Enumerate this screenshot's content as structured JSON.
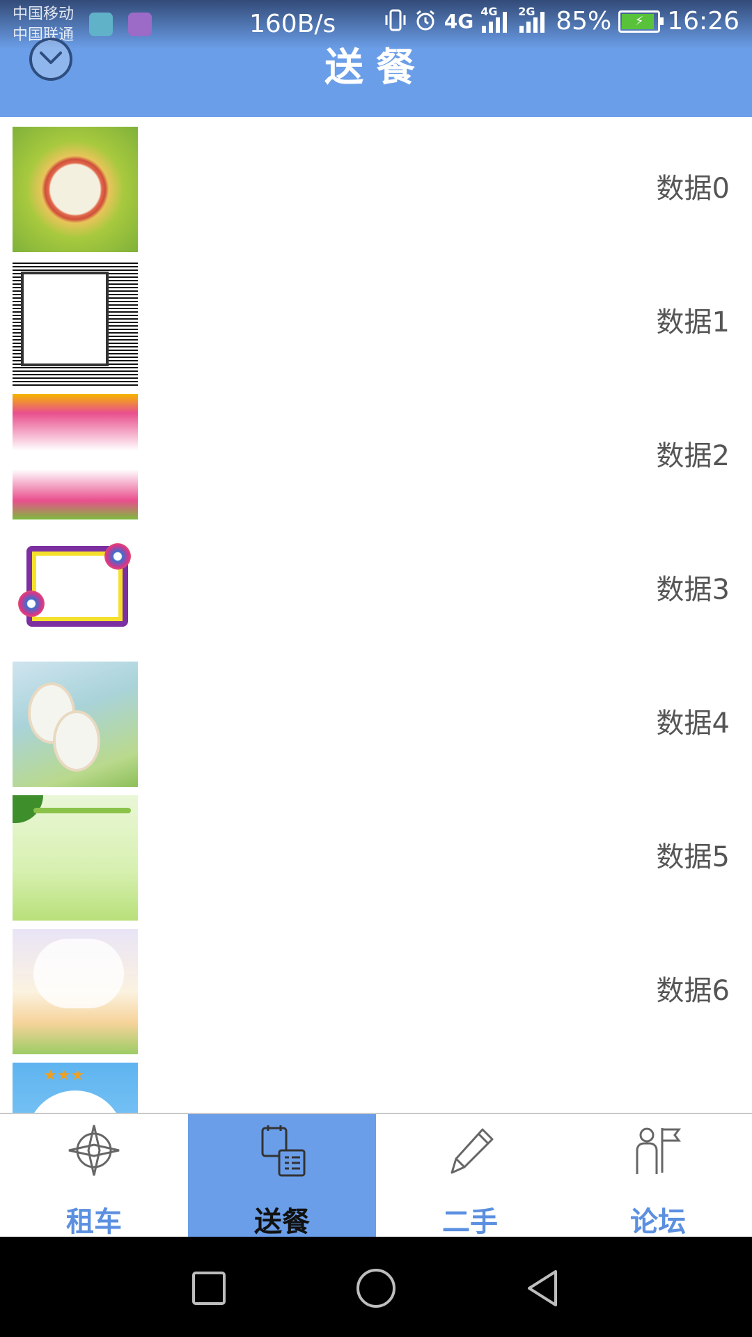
{
  "status_bar": {
    "carrier_1": "中国移动",
    "carrier_2": "中国联通",
    "net_speed": "160B/s",
    "network_1": "4G",
    "network_2": "4G",
    "network_3": "2G",
    "battery": "85%",
    "time": "16:26",
    "battery_color": "#57c23a"
  },
  "header": {
    "title": "送餐",
    "background": "#6b9ee8",
    "menu_icon": "chevron-down-circle-icon"
  },
  "list": {
    "items": [
      {
        "label": "数据0",
        "thumb": "floral-frame-thumbnail"
      },
      {
        "label": "数据1",
        "thumb": "sketch-frame-thumbnail"
      },
      {
        "label": "数据2",
        "thumb": "paint-splash-frame-thumbnail"
      },
      {
        "label": "数据3",
        "thumb": "colorful-frame-thumbnail"
      },
      {
        "label": "数据4",
        "thumb": "spring-frame-thumbnail"
      },
      {
        "label": "数据5",
        "thumb": "green-frame-thumbnail"
      },
      {
        "label": "数据6",
        "thumb": "cloud-frame-thumbnail"
      },
      {
        "label": "",
        "thumb": "study-star-thumbnail"
      }
    ]
  },
  "tabs": [
    {
      "label": "租车",
      "icon": "compass-icon",
      "active": false
    },
    {
      "label": "送餐",
      "icon": "clipboard-list-icon",
      "active": true
    },
    {
      "label": "二手",
      "icon": "pencil-icon",
      "active": false
    },
    {
      "label": "论坛",
      "icon": "people-flag-icon",
      "active": false
    }
  ],
  "accent_color": "#6b9ee8",
  "tab_label_color": "#5b8fe0"
}
